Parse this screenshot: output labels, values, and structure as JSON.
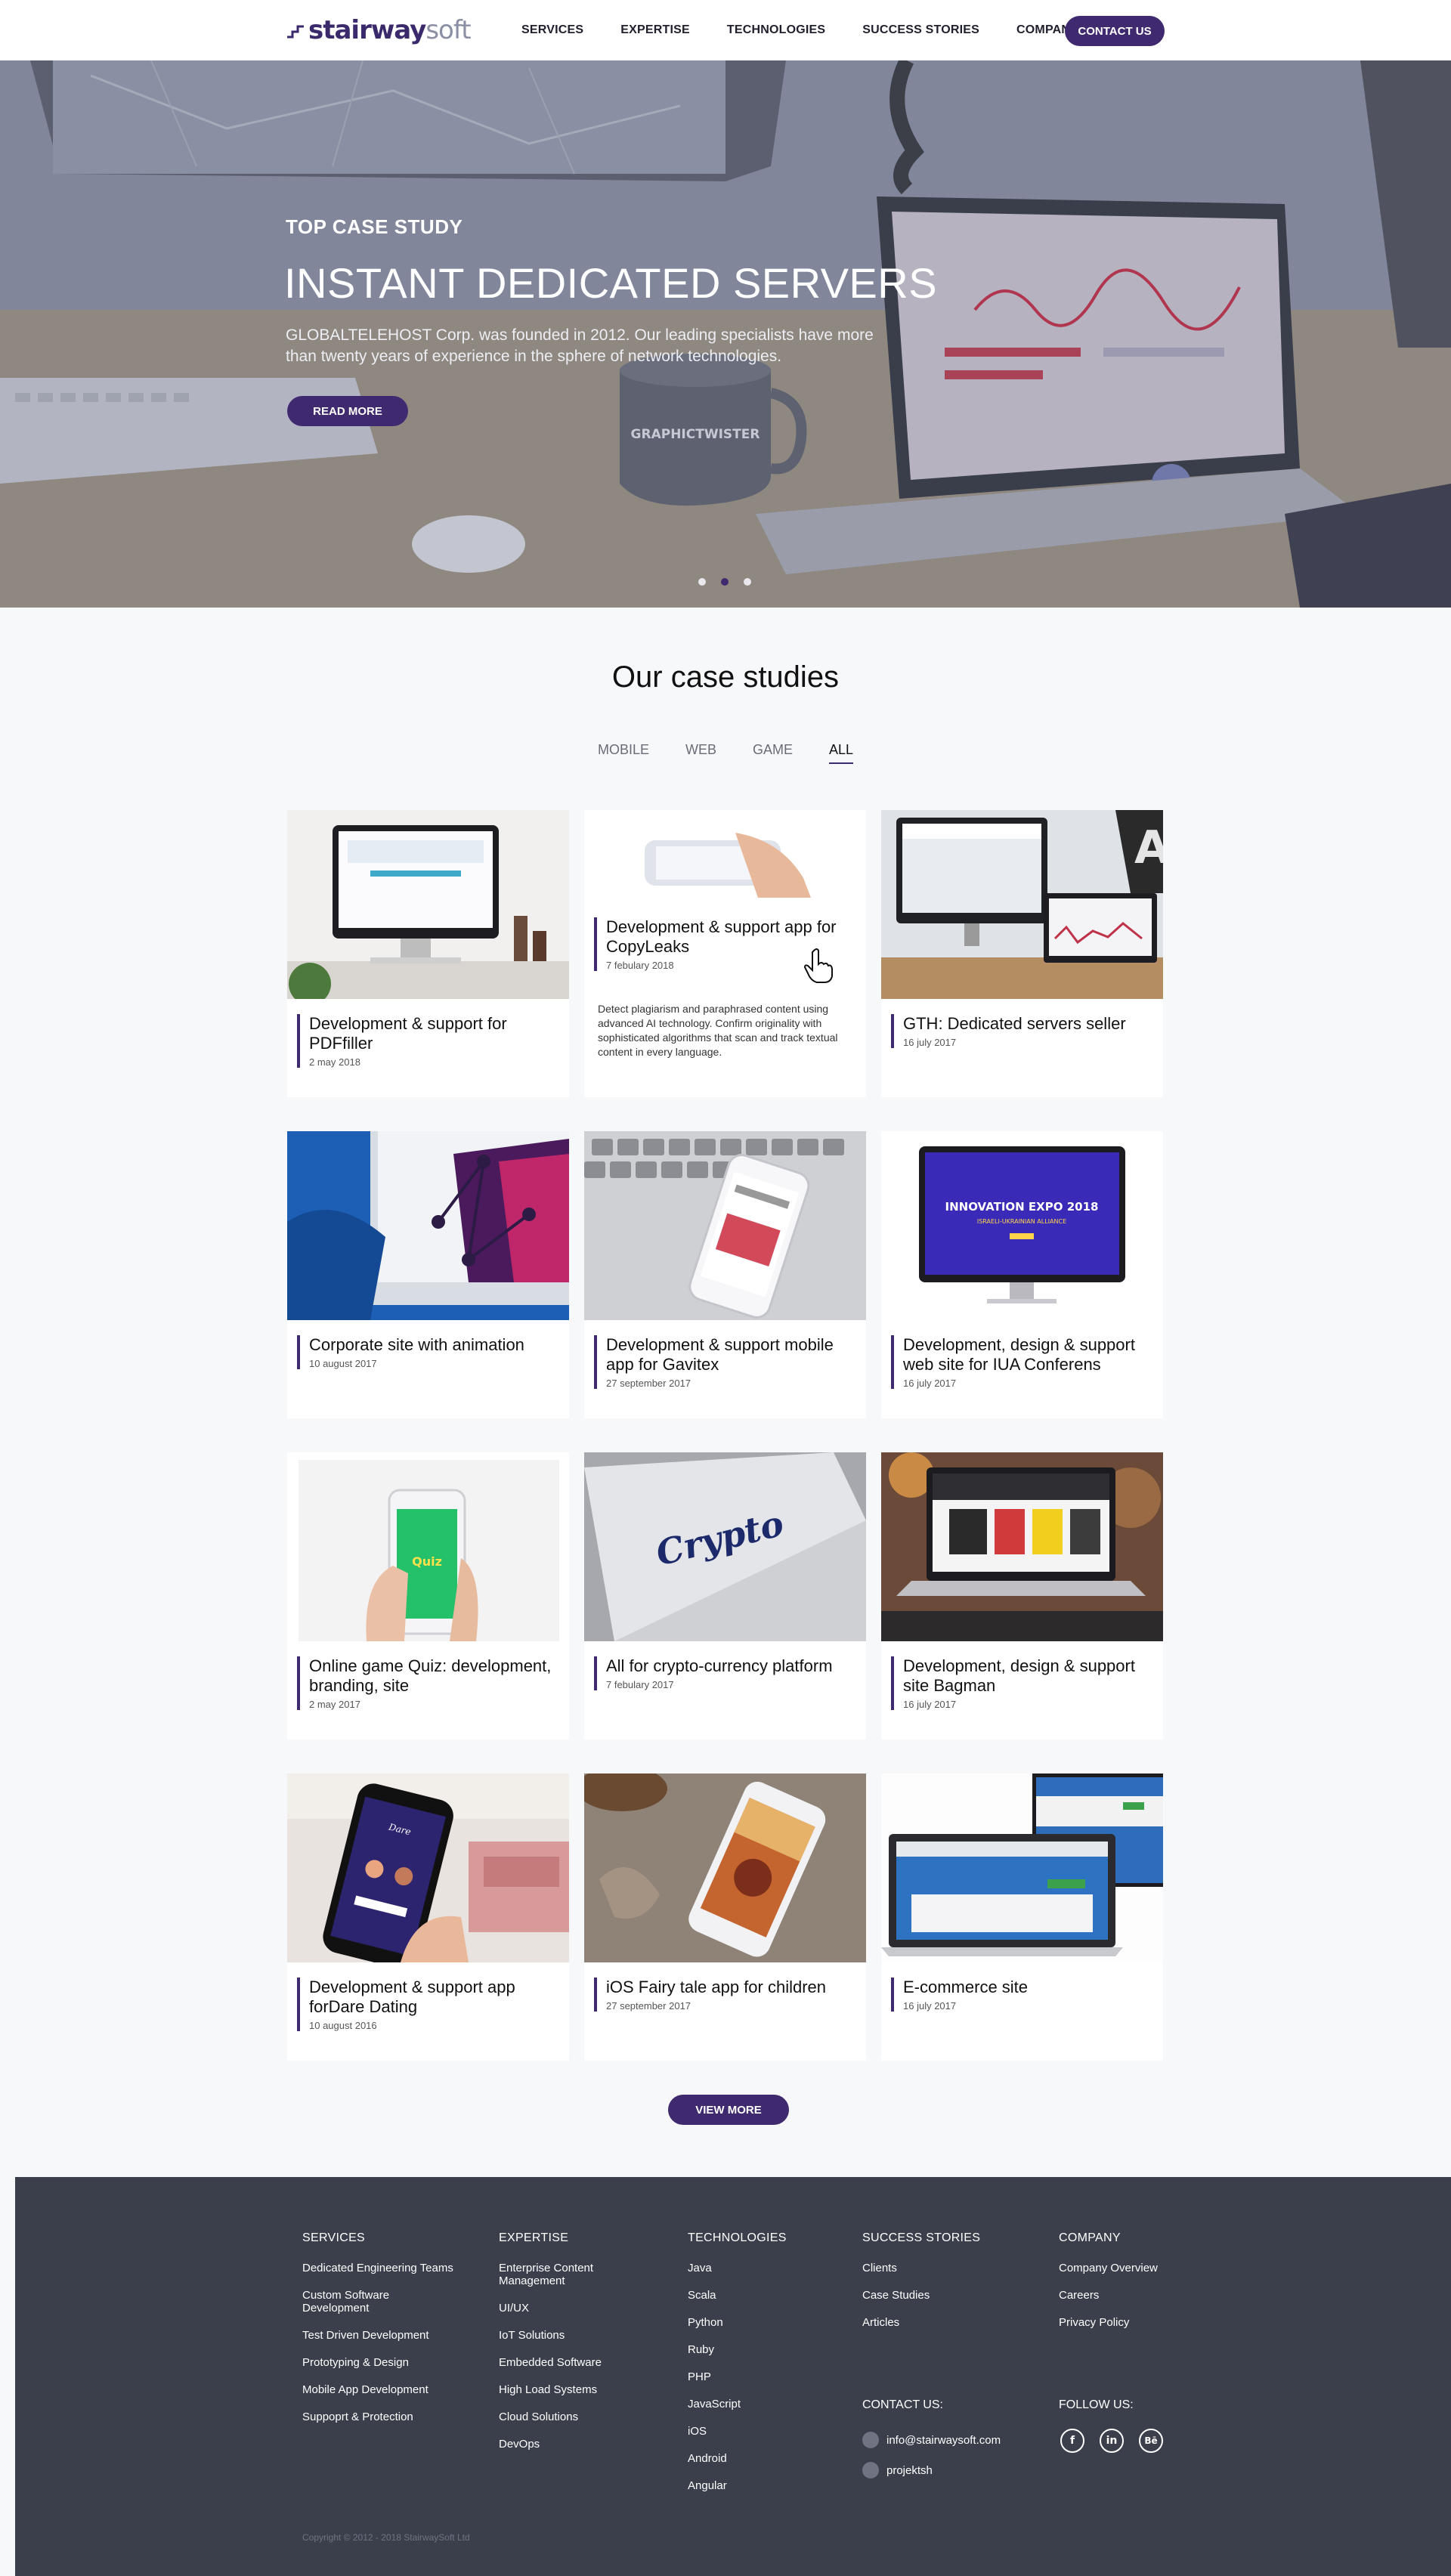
{
  "header": {
    "logo_strong": "stairway",
    "logo_light": "soft",
    "nav": [
      "SERVICES",
      "EXPERTISE",
      "TECHNOLOGIES",
      "SUCCESS STORIES",
      "COMPANY"
    ],
    "contact_label": "CONTACT US"
  },
  "hero": {
    "kicker": "TOP CASE STUDY",
    "title": "INSTANT DEDICATED SERVERS",
    "description": "GLOBALTELEHOST Corp. was founded in 2012. Our leading specialists have more than twenty years of experience in the sphere of network technologies.",
    "button": "READ MORE",
    "mug_text": "GRAPHICTWISTER",
    "slides_total": 3,
    "active_slide": 2
  },
  "cases": {
    "title": "Our case studies",
    "filters": [
      "MOBILE",
      "WEB",
      "GAME",
      "ALL"
    ],
    "active_filter": "ALL",
    "items": [
      {
        "title": "Development & support for PDFfiller",
        "date": "2 may 2018"
      },
      {
        "title": "Development & support app for CopyLeaks",
        "date": "7 febulary 2018",
        "description": "Detect plagiarism and paraphrased content using advanced AI technology. Confirm originality with sophisticated algorithms that scan and track textual content in every language."
      },
      {
        "title": "GTH: Dedicated servers seller",
        "date": "16 july 2017"
      },
      {
        "title": "Corporate site with animation",
        "date": "10 august 2017"
      },
      {
        "title": "Development & support mobile app for Gavitex",
        "date": "27 september 2017"
      },
      {
        "title": "Development, design & support web site for IUA Conferens",
        "date": "16 july 2017"
      },
      {
        "title": "Online game Quiz: development, branding, site",
        "date": "2 may 2017"
      },
      {
        "title": "All for crypto-currency platform",
        "date": "7 febulary 2017"
      },
      {
        "title": "Development, design & support site Bagman",
        "date": "16 july 2017"
      },
      {
        "title": "Development & support app forDare Dating",
        "date": "10 august 2016"
      },
      {
        "title": "iOS Fairy tale app for children",
        "date": "27 september 2017"
      },
      {
        "title": "E-commerce site",
        "date": "16 july 2017"
      }
    ],
    "thumb_texts": {
      "expo_line1": "INNOVATION EXPO 2018",
      "expo_line2": "ISRAELI-UKRAINIAN ALLIANCE",
      "crypto": "Crypto"
    },
    "view_more": "VIEW MORE"
  },
  "footer": {
    "services": {
      "heading": "SERVICES",
      "links": [
        "Dedicated Engineering Teams",
        "Custom Software Development",
        "Test Driven Development",
        "Prototyping & Design",
        "Mobile App Development",
        "Suppoprt & Protection"
      ]
    },
    "expertise": {
      "heading": "EXPERTISE",
      "links": [
        "Enterprise Content Management",
        "UI/UX",
        "IoT Solutions",
        "Embedded Software",
        "High Load Systems",
        "Cloud Solutions",
        "DevOps"
      ]
    },
    "technologies": {
      "heading": "TECHNOLOGIES",
      "links": [
        "Java",
        "Scala",
        "Python",
        "Ruby",
        "PHP",
        "JavaScript",
        "iOS",
        "Android",
        "Angular"
      ]
    },
    "success": {
      "heading": "SUCCESS STORIES",
      "links": [
        "Clients",
        "Case Studies",
        "Articles"
      ]
    },
    "company": {
      "heading": "COMPANY",
      "links": [
        "Company Overview",
        "Careers",
        "Privacy Policy"
      ]
    },
    "contact": {
      "heading": "CONTACT US:",
      "email": "info@stairwaysoft.com",
      "skype": "projektsh"
    },
    "follow": {
      "heading": "FOLLOW US:",
      "icons": [
        "facebook-icon",
        "linkedin-icon",
        "behance-icon"
      ],
      "glyphs": [
        "f",
        "in",
        "Bē"
      ]
    },
    "copyright": "Copyright © 2012 - 2018 StairwaySoft Ltd"
  },
  "colors": {
    "accent": "#3f2a70",
    "footer_bg": "#3b3f4b",
    "page_bg": "#f7f8fa"
  }
}
